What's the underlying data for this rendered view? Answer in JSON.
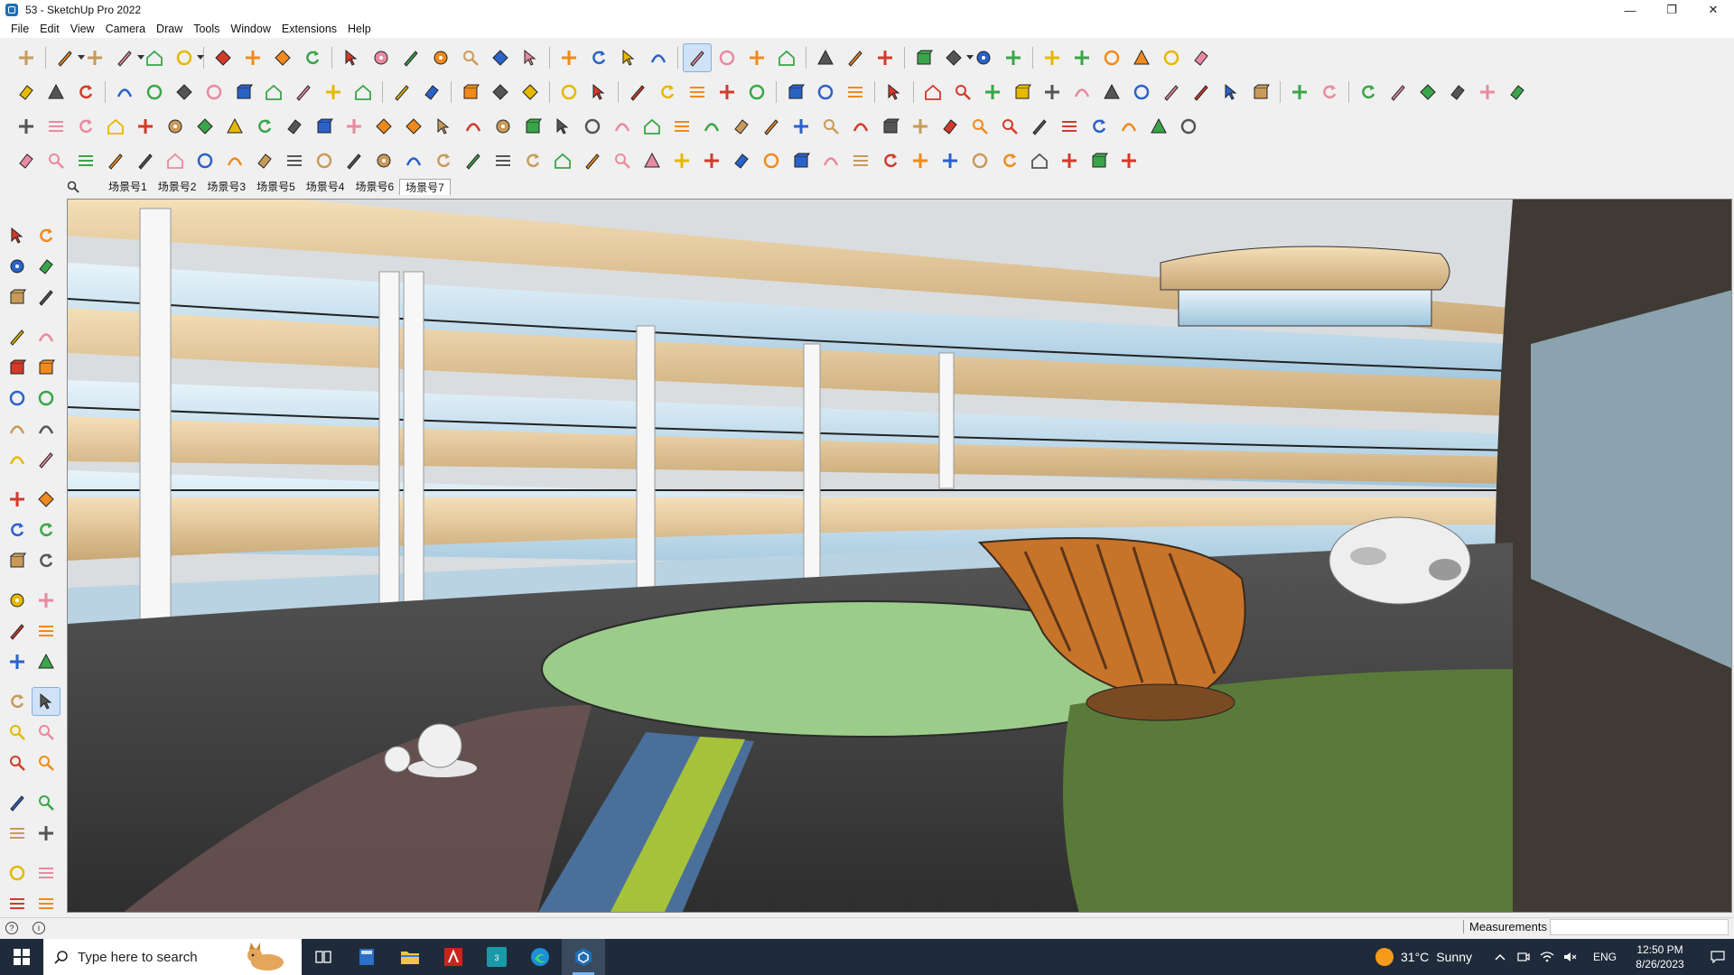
{
  "window": {
    "title": "53 - SketchUp Pro 2022",
    "controls": {
      "minimize": "—",
      "maximize": "❐",
      "close": "✕"
    }
  },
  "menu": [
    "File",
    "Edit",
    "View",
    "Camera",
    "Draw",
    "Tools",
    "Window",
    "Extensions",
    "Help"
  ],
  "scenes": {
    "tabs": [
      "场景号1",
      "场景号2",
      "场景号3",
      "场景号5",
      "场景号4",
      "场景号6",
      "场景号7"
    ],
    "active_index": 6
  },
  "tool_colors": {
    "red": "#d23a2a",
    "orange": "#f08a1c",
    "blue": "#2a62c8",
    "green": "#3aa548",
    "tan": "#c89a5a",
    "gray": "#555555",
    "yellow": "#e6b800",
    "pink": "#e88aa0"
  },
  "status": {
    "measurements_label": "Measurements",
    "measurements_value": ""
  },
  "taskbar": {
    "search_placeholder": "Type here to search",
    "apps": [
      "task-view-icon",
      "calculator-icon",
      "file-explorer-icon",
      "acrobat-icon",
      "3dsmax-icon",
      "edge-icon",
      "sketchup-icon"
    ],
    "weather_temp": "31°C",
    "weather_desc": "Sunny",
    "language": "ENG",
    "time": "12:50 PM",
    "date": "8/26/2023"
  }
}
